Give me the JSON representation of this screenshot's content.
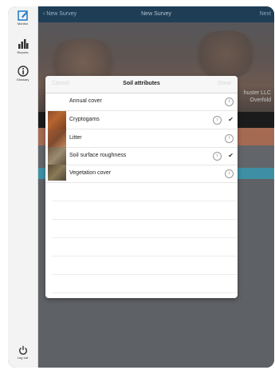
{
  "sidebar": {
    "items": [
      {
        "label": "Monitor",
        "icon": "edit-icon"
      },
      {
        "label": "Reports",
        "icon": "bar-chart-icon"
      },
      {
        "label": "Glossary",
        "icon": "info-icon"
      }
    ],
    "logout_label": "Log out"
  },
  "navbar": {
    "back_label": "New Survey",
    "title": "New Survey",
    "next_label": "Next"
  },
  "hero": {
    "company_line1": "huster LLC",
    "company_line2": "Overfold"
  },
  "modal": {
    "title": "Soil attributes",
    "left_action": "Cancel",
    "right_action": "Done",
    "rows": [
      {
        "label": "Annual cover",
        "checked": false
      },
      {
        "label": "Cryptogams",
        "checked": true
      },
      {
        "label": "Litter",
        "checked": false
      },
      {
        "label": "Soil surface roughness",
        "checked": true
      },
      {
        "label": "Vegetation cover",
        "checked": false
      }
    ],
    "check_glyph": "✔",
    "info_glyph": "i"
  },
  "colors": {
    "navbar": "#1f3e56",
    "teal": "#3e8fa4",
    "accent": "#a46a52"
  }
}
